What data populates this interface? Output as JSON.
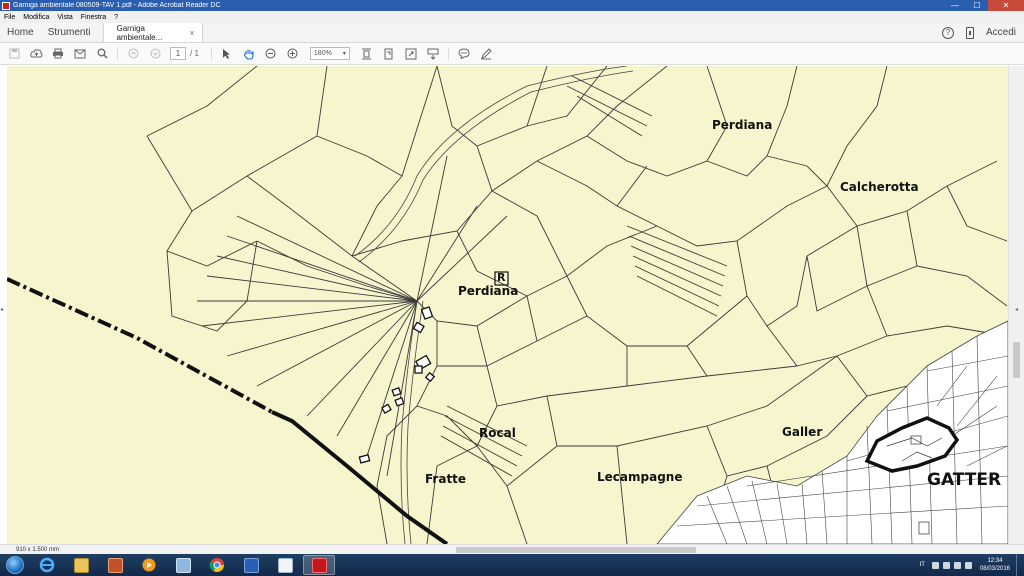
{
  "window": {
    "title": "Garniga ambientale 080509-TAV 1.pdf - Adobe Acrobat Reader DC",
    "controls": {
      "minimize": "—",
      "maximize": "☐",
      "close": "✕"
    }
  },
  "menu": {
    "items": [
      "File",
      "Modifica",
      "Vista",
      "Finestra",
      "?"
    ]
  },
  "nav": {
    "home": "Home",
    "tools": "Strumenti",
    "doc_tab": "Garniga ambientale...",
    "doc_tab_close": "×",
    "help": "?",
    "signin": "Accedi"
  },
  "toolbar": {
    "page_current": "1",
    "page_total": "/ 1",
    "zoom": "180%"
  },
  "map": {
    "background": "#f7f5cd",
    "labels": {
      "perdiana_north": "Perdiana",
      "calcherotta": "Calcherotta",
      "perdiana_center": "Perdiana",
      "r_marker": "R",
      "rocal": "Rocal",
      "galler": "Galler",
      "fratte": "Fratte",
      "lecampagne": "Lecampagne",
      "gatter": "GATTER"
    }
  },
  "status": {
    "dimensions": "910 x 1.500 mm"
  },
  "taskbar": {
    "apps": [
      "internet-explorer",
      "file-explorer",
      "windows-media",
      "media-player",
      "control-panel",
      "chrome",
      "word-blue",
      "notepad",
      "acrobat"
    ],
    "language": "IT",
    "time": "12:34",
    "date": "08/03/2016"
  }
}
